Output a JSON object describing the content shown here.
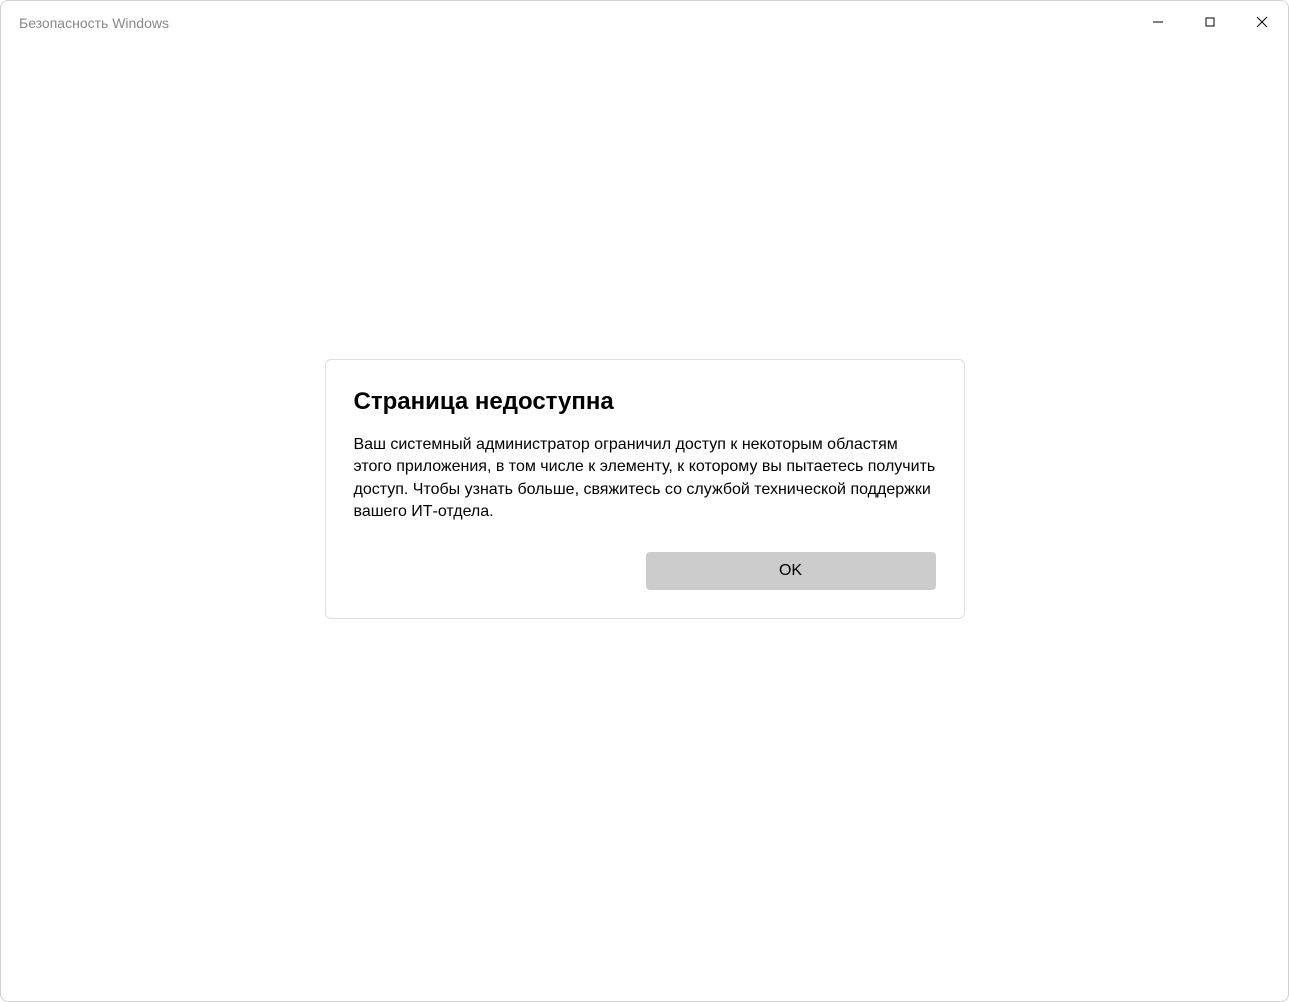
{
  "window": {
    "title": "Безопасность Windows"
  },
  "dialog": {
    "title": "Страница недоступна",
    "message": "Ваш системный администратор ограничил доступ к некоторым областям этого приложения, в том числе к элементу, к которому вы пытаетесь получить доступ. Чтобы узнать больше, свяжитесь со службой технической поддержки вашего ИТ-отдела.",
    "ok_label": "OK"
  }
}
